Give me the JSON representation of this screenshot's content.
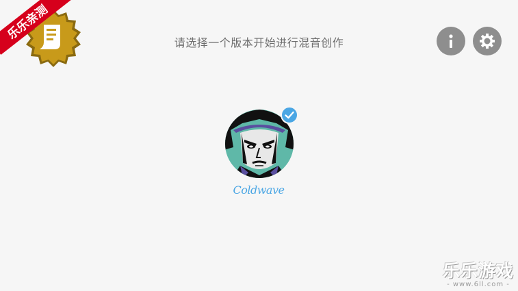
{
  "header": {
    "title": "请选择一个版本开始进行混音创作"
  },
  "corner_badge": {
    "text": "乐乐亲测",
    "icon": "receipt-icon",
    "ribbon_color": "#d6001c",
    "seal_color": "#c89a1a"
  },
  "buttons": {
    "info_icon": "info-icon",
    "settings_icon": "gear-icon",
    "color": "#8e8e8e"
  },
  "versions": [
    {
      "name": "Coldwave",
      "selected": true,
      "accent": "#4aa6e4"
    }
  ],
  "watermark": {
    "title": "乐乐游戏",
    "url": "- www.6ll.com -"
  }
}
